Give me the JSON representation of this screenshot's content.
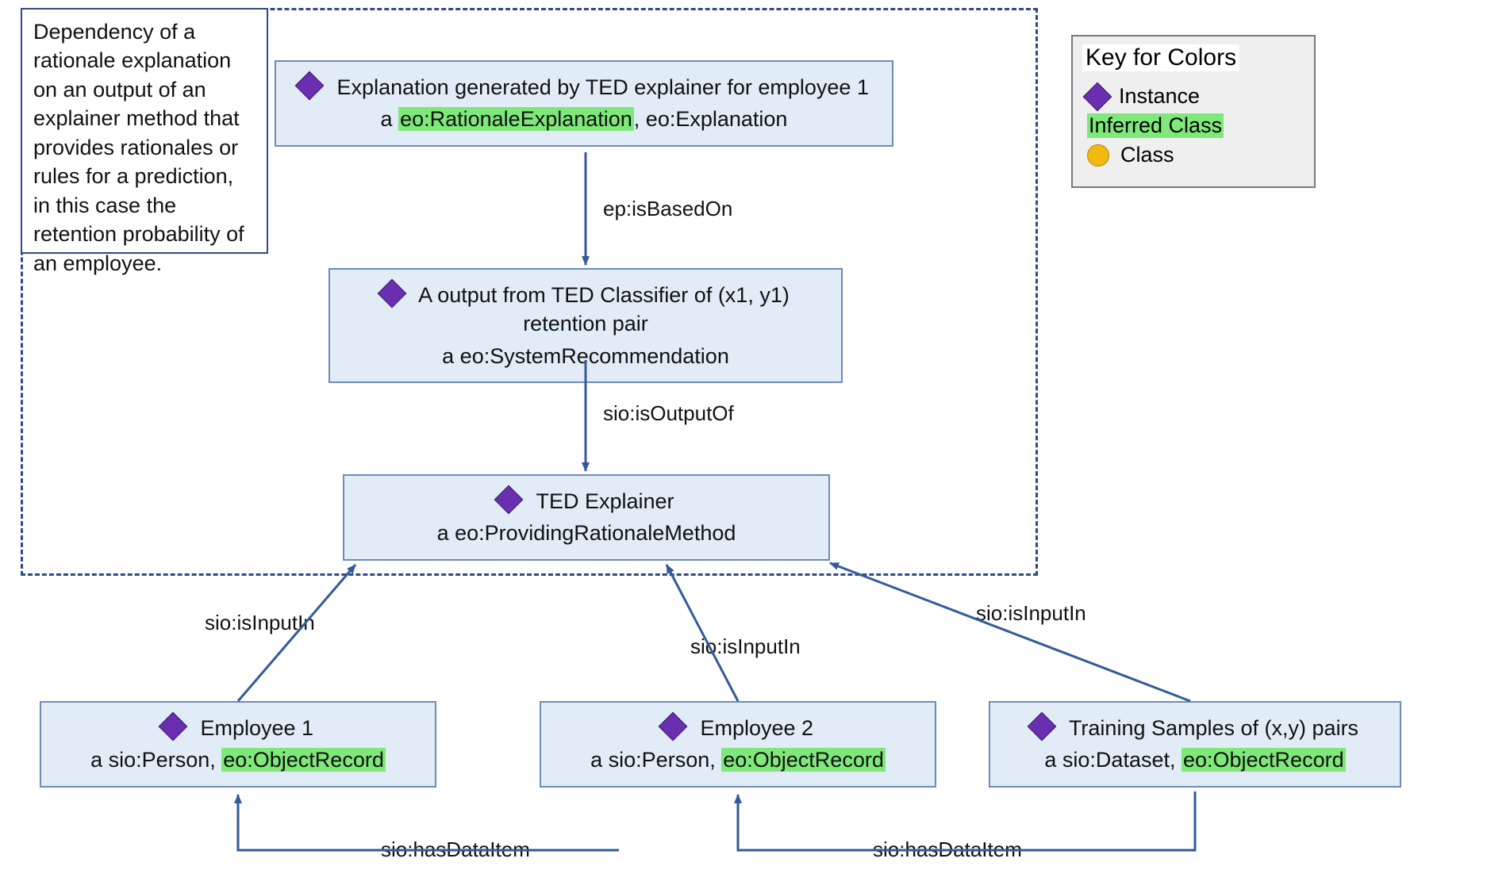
{
  "description": {
    "text": "Dependency of a rationale explanation on an output of an explainer method that provides rationales or rules for a prediction, in this case the retention probability of an employee."
  },
  "legend": {
    "title": "Key for Colors",
    "items": {
      "instance": "Instance",
      "inferred": "Inferred Class",
      "class": "Class"
    }
  },
  "nodes": {
    "explanation": {
      "title": "Explanation generated by TED explainer for employee 1",
      "type_prefix": "a ",
      "type_infer": "eo:RationaleExplanation",
      "type_rest": ", eo:Explanation"
    },
    "output": {
      "title": "A output from TED Classifier of (x1, y1) retention pair",
      "type_line": "a eo:SystemRecommendation"
    },
    "explainer": {
      "title": "TED Explainer",
      "type_line": "a eo:ProvidingRationaleMethod"
    },
    "emp1": {
      "title": "Employee 1",
      "type_prefix": "a sio:Person, ",
      "type_infer": "eo:ObjectRecord"
    },
    "emp2": {
      "title": "Employee 2",
      "type_prefix": "a sio:Person, ",
      "type_infer": "eo:ObjectRecord"
    },
    "training": {
      "title": "Training Samples of (x,y) pairs",
      "type_prefix": "a sio:Dataset, ",
      "type_infer": "eo:ObjectRecord"
    }
  },
  "edges": {
    "isBasedOn": "ep:isBasedOn",
    "isOutputOf": "sio:isOutputOf",
    "isInputIn1": "sio:isInputIn",
    "isInputIn2": "sio:isInputIn",
    "isInputIn3": "sio:isInputIn",
    "hasDataItem1": "sio:hasDataItem",
    "hasDataItem2": "sio:hasDataItem"
  },
  "colors": {
    "node_fill": "#e1ecf7",
    "node_border": "#6e8cb8",
    "arrow": "#335a9a",
    "dashed": "#2f4a8a",
    "highlight": "#7fe87a",
    "instance": "#6a2fb1",
    "class": "#f2b90f"
  }
}
